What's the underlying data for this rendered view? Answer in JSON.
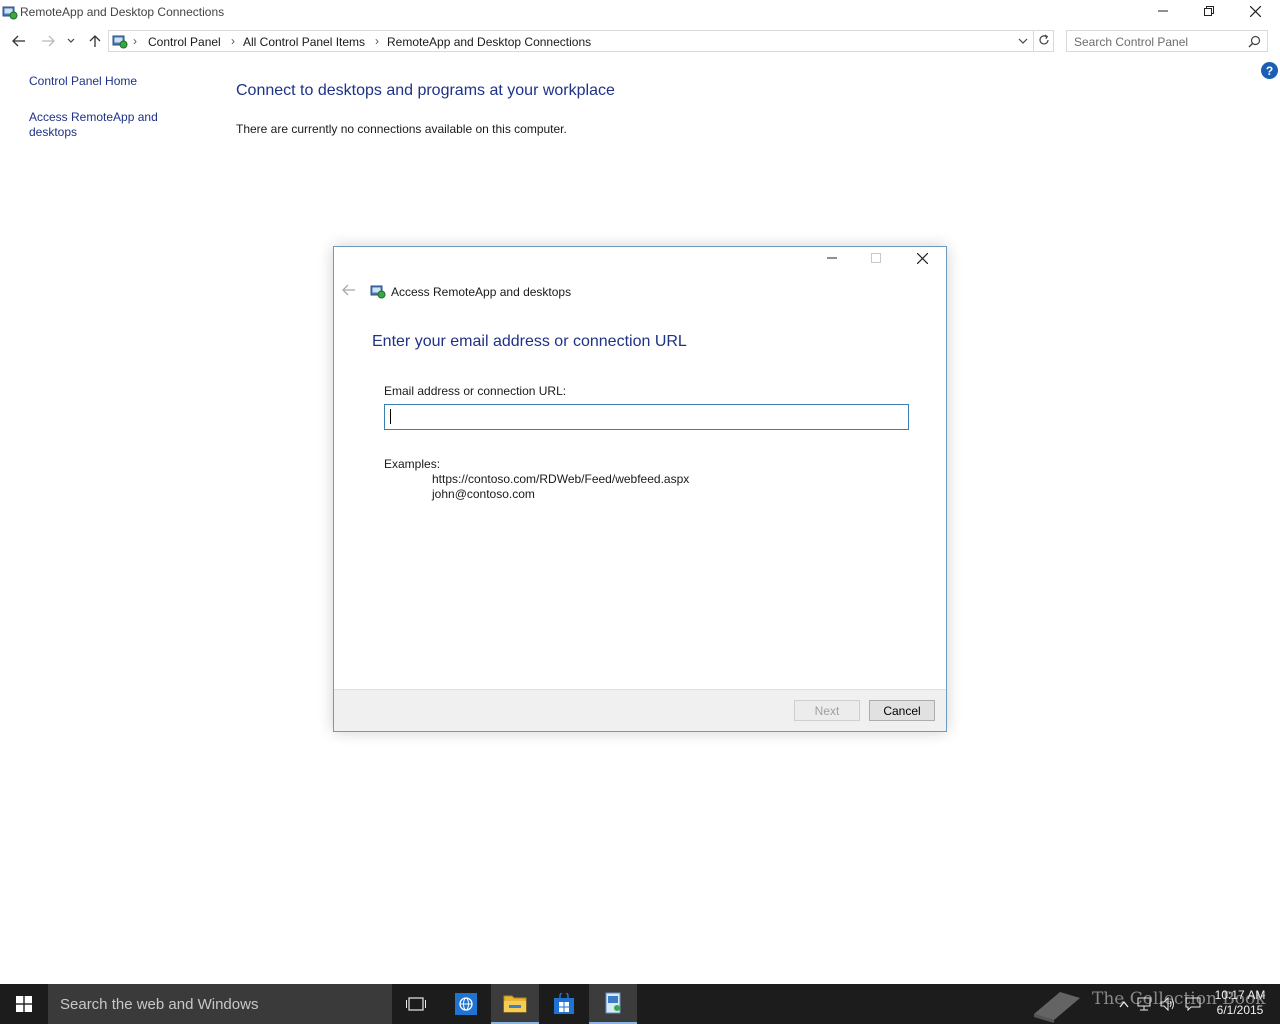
{
  "window": {
    "title": "RemoteApp and Desktop Connections"
  },
  "address_bar": {
    "crumbs": [
      "Control Panel",
      "All Control Panel Items",
      "RemoteApp and Desktop Connections"
    ]
  },
  "search": {
    "placeholder": "Search Control Panel"
  },
  "left_nav": {
    "home_label": "Control Panel Home",
    "access_label_line1": "Access RemoteApp and",
    "access_label_line2": "desktops"
  },
  "main": {
    "heading": "Connect to desktops and programs at your workplace",
    "status_text": "There are currently no connections available on this computer."
  },
  "dialog": {
    "title": "Access RemoteApp and desktops",
    "heading": "Enter your email address or connection URL",
    "field_label": "Email address or connection URL:",
    "field_value": "",
    "examples_label": "Examples:",
    "examples": [
      "https://contoso.com/RDWeb/Feed/webfeed.aspx",
      "john@contoso.com"
    ],
    "next_label": "Next",
    "cancel_label": "Cancel"
  },
  "taskbar": {
    "search_text": "Search the web and Windows",
    "time": "10:17 AM",
    "date": "6/1/2015",
    "watermark": "The Collection Book"
  },
  "colors": {
    "link_blue": "#1e3287",
    "taskbar_bg": "#1c1c1c",
    "input_border": "#3c7fb1"
  },
  "icons": [
    "control-panel-icon",
    "back-arrow-icon",
    "forward-arrow-icon",
    "up-arrow-icon",
    "refresh-icon",
    "search-icon",
    "help-icon",
    "windows-start-icon",
    "task-view-icon",
    "ie-icon",
    "file-explorer-icon",
    "store-icon",
    "remoteapp-icon"
  ]
}
